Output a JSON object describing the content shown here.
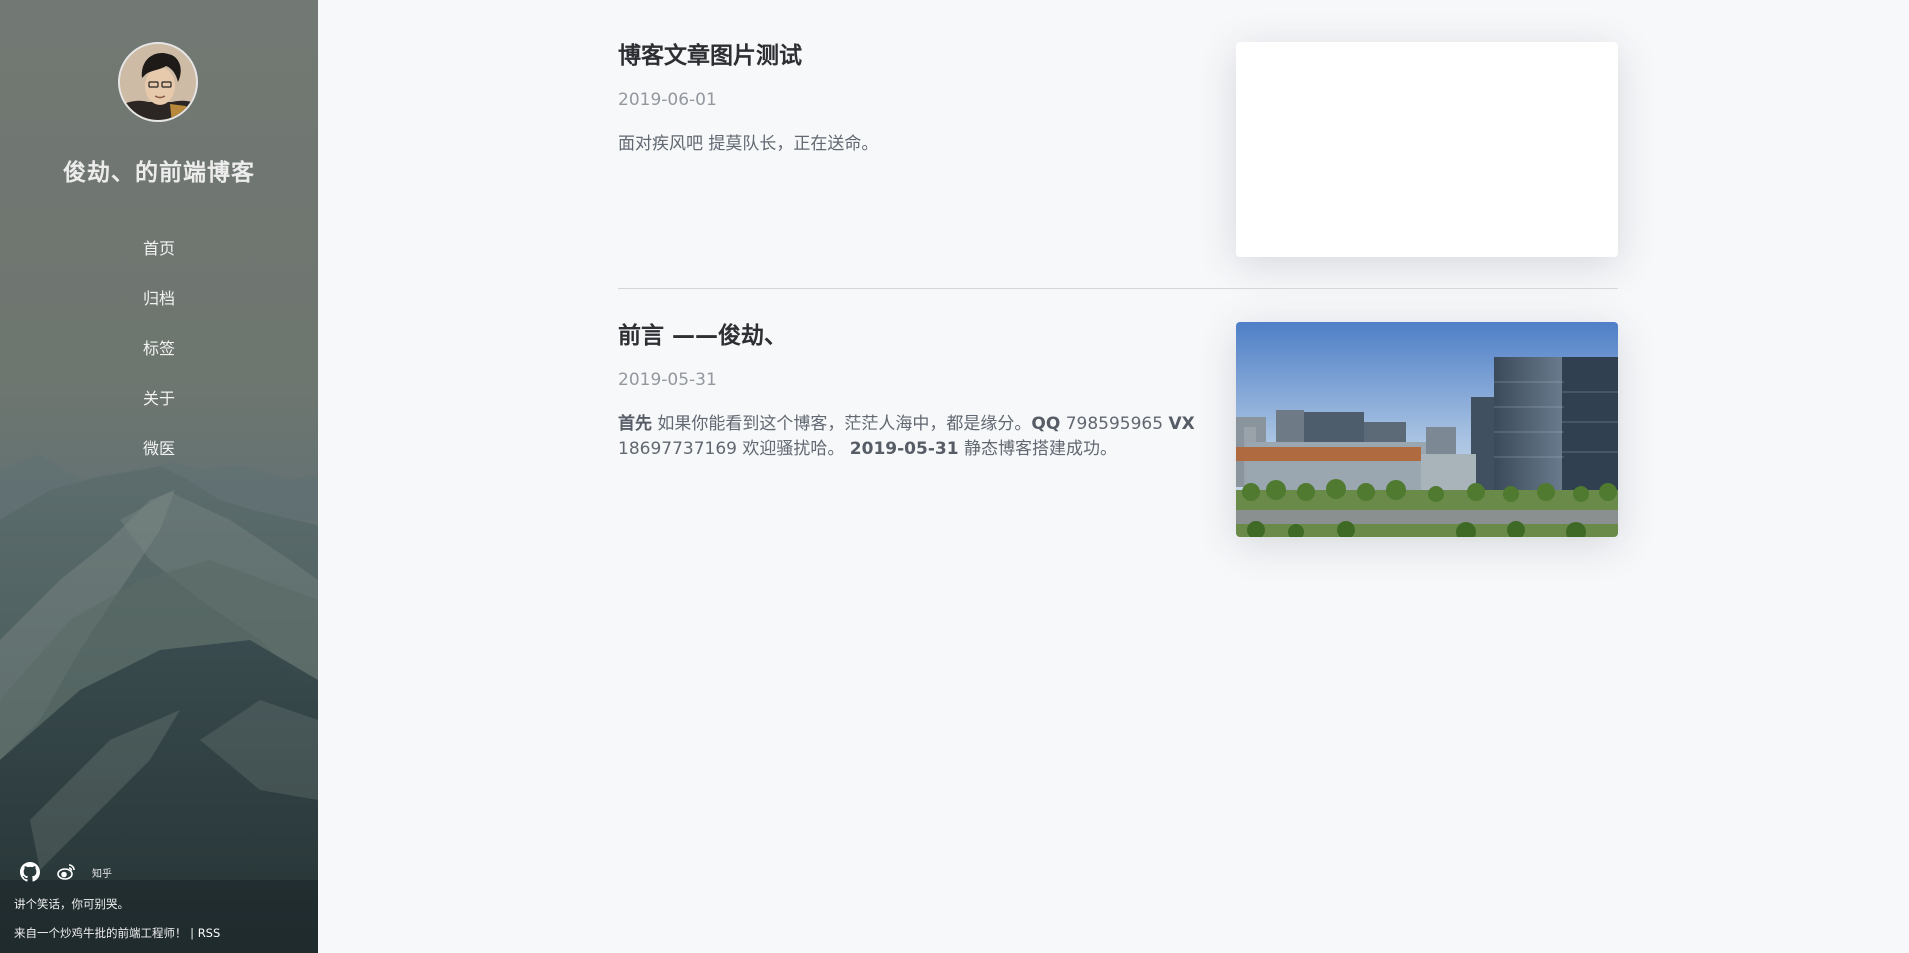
{
  "sidebar": {
    "site_title": "俊劫、的前端博客",
    "nav": [
      {
        "label": "首页"
      },
      {
        "label": "归档"
      },
      {
        "label": "标签"
      },
      {
        "label": "关于"
      },
      {
        "label": "微医"
      }
    ],
    "social": {
      "github_icon": "github-icon",
      "weibo_icon": "weibo-icon",
      "zhihu_label": "知乎"
    },
    "tagline": "讲个笑话，你可别哭。",
    "footer": {
      "text": "来自一个炒鸡牛批的前端工程师！ | ",
      "rss": "RSS"
    }
  },
  "posts": [
    {
      "title": "博客文章图片测试",
      "date": "2019-06-01",
      "excerpt": "面对疾风吧 提莫队长，正在送命。"
    },
    {
      "title": "前言 ——俊劫、",
      "date": "2019-05-31",
      "excerpt_parts": {
        "b1": "首先",
        "t1": " 如果你能看到这个博客，茫茫人海中，都是缘分。",
        "b2": "QQ",
        "t2": " 798595965 ",
        "b3": "VX",
        "t3": " 18697737169 欢迎骚扰哈。 ",
        "b4": "2019-05-31",
        "t4": " 静态博客搭建成功。"
      }
    }
  ],
  "colors": {
    "accent_text": "#2d2f33",
    "muted": "#93989f",
    "background": "#f7f8fa"
  }
}
